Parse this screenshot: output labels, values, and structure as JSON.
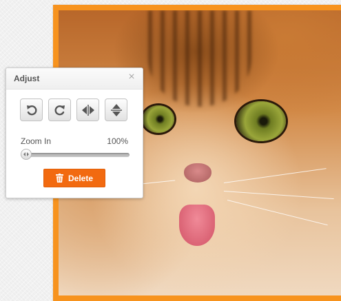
{
  "photo": {
    "frame_color": "#f7931e"
  },
  "adjust_panel": {
    "title": "Adjust",
    "close_icon": "close-icon",
    "tools": [
      {
        "name": "rotate-left-button",
        "icon": "rotate-left-icon"
      },
      {
        "name": "rotate-right-button",
        "icon": "rotate-right-icon"
      },
      {
        "name": "flip-horizontal-button",
        "icon": "flip-horizontal-icon"
      },
      {
        "name": "flip-vertical-button",
        "icon": "flip-vertical-icon"
      }
    ],
    "zoom": {
      "label": "Zoom In",
      "value_text": "100%",
      "slider_level": 0
    },
    "delete": {
      "label": "Delete",
      "icon": "trash-icon",
      "color": "#f26a10"
    }
  }
}
